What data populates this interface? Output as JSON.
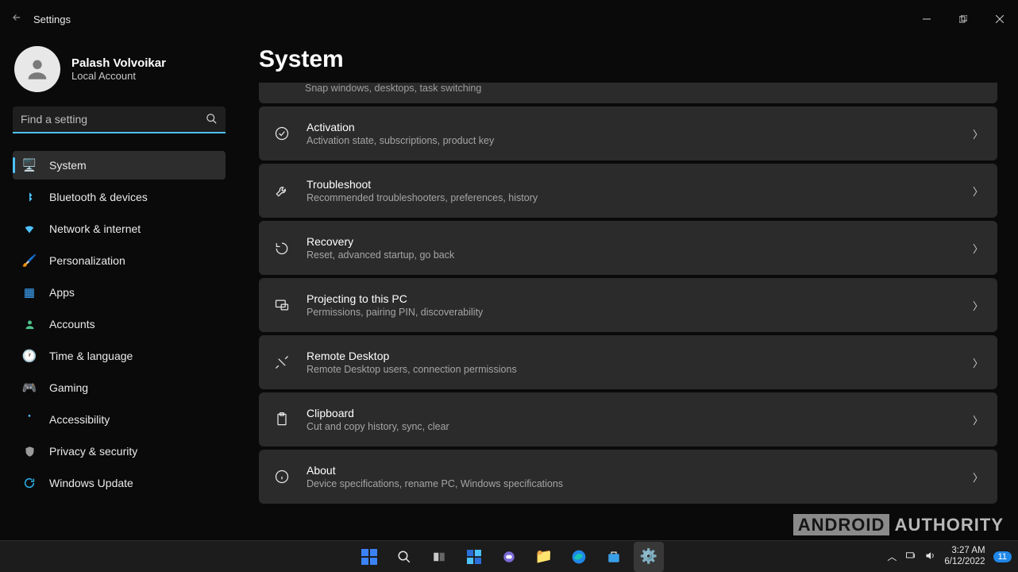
{
  "window": {
    "title": "Settings"
  },
  "user": {
    "name": "Palash Volvoikar",
    "sub": "Local Account"
  },
  "search": {
    "placeholder": "Find a setting"
  },
  "nav": {
    "items": [
      {
        "label": "System"
      },
      {
        "label": "Bluetooth & devices"
      },
      {
        "label": "Network & internet"
      },
      {
        "label": "Personalization"
      },
      {
        "label": "Apps"
      },
      {
        "label": "Accounts"
      },
      {
        "label": "Time & language"
      },
      {
        "label": "Gaming"
      },
      {
        "label": "Accessibility"
      },
      {
        "label": "Privacy & security"
      },
      {
        "label": "Windows Update"
      }
    ]
  },
  "page": {
    "title": "System",
    "cut_sub": "Snap windows, desktops, task switching"
  },
  "settings": [
    {
      "title": "Activation",
      "sub": "Activation state, subscriptions, product key"
    },
    {
      "title": "Troubleshoot",
      "sub": "Recommended troubleshooters, preferences, history"
    },
    {
      "title": "Recovery",
      "sub": "Reset, advanced startup, go back"
    },
    {
      "title": "Projecting to this PC",
      "sub": "Permissions, pairing PIN, discoverability"
    },
    {
      "title": "Remote Desktop",
      "sub": "Remote Desktop users, connection permissions"
    },
    {
      "title": "Clipboard",
      "sub": "Cut and copy history, sync, clear"
    },
    {
      "title": "About",
      "sub": "Device specifications, rename PC, Windows specifications"
    }
  ],
  "taskbar": {
    "time": "3:27 AM",
    "date": "6/12/2022",
    "badge": "11"
  },
  "watermark": {
    "a": "ANDROID",
    "b": "AUTHORITY"
  }
}
